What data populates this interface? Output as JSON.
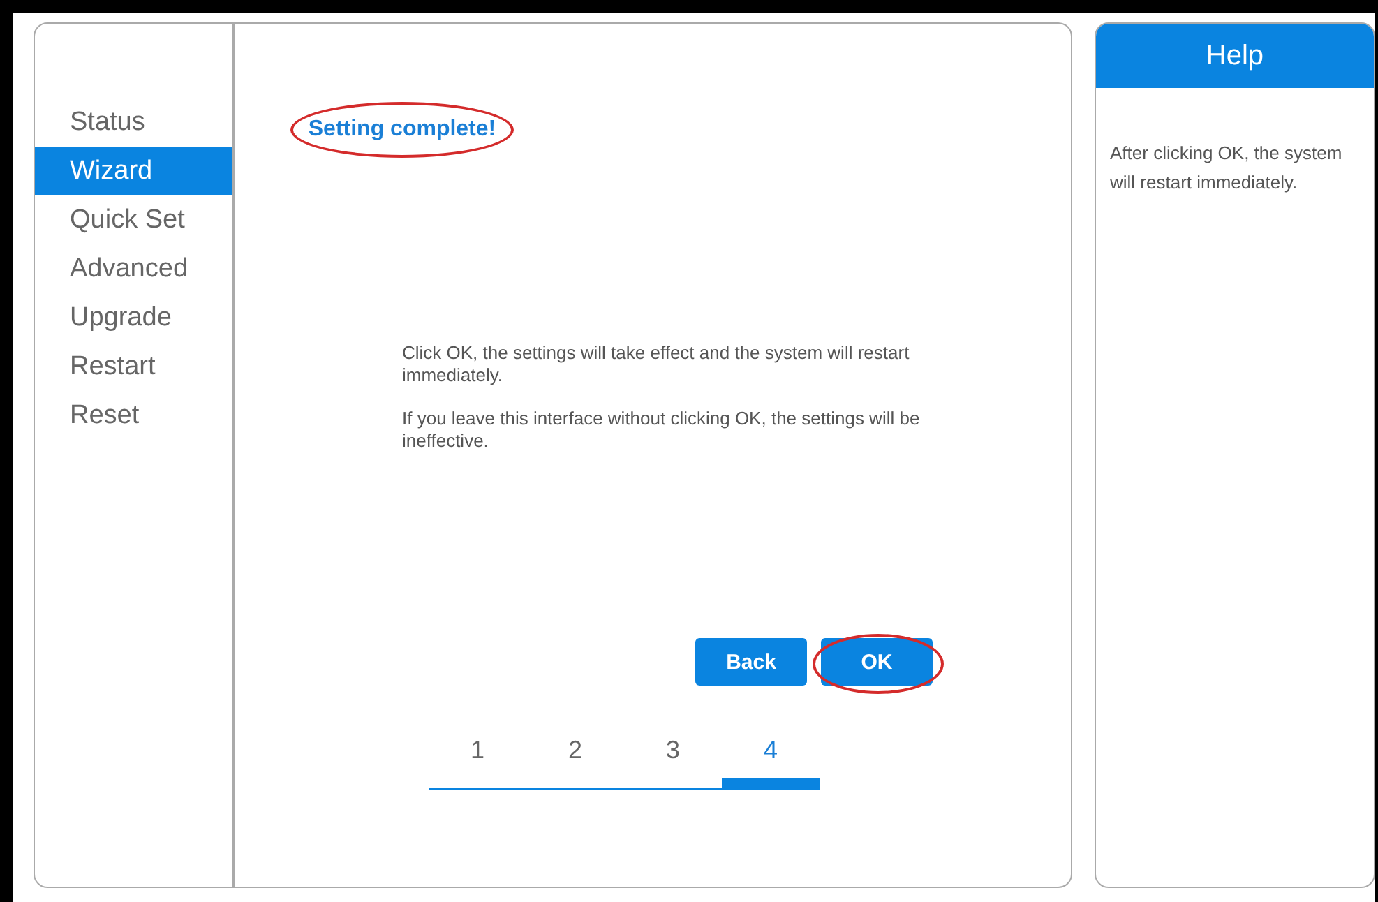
{
  "sidebar": {
    "items": [
      {
        "label": "Status",
        "selected": false
      },
      {
        "label": "Wizard",
        "selected": true
      },
      {
        "label": "Quick Set",
        "selected": false
      },
      {
        "label": "Advanced",
        "selected": false
      },
      {
        "label": "Upgrade",
        "selected": false
      },
      {
        "label": "Restart",
        "selected": false
      },
      {
        "label": "Reset",
        "selected": false
      }
    ]
  },
  "main": {
    "title": {
      "text": "Setting complete!",
      "circled": true
    },
    "paragraphs": [
      "Click OK, the settings will take effect and the system will restart immediately.",
      "If you leave this interface without clicking OK, the settings will be ineffective."
    ],
    "buttons": [
      {
        "label": "Back",
        "circled": false
      },
      {
        "label": "OK",
        "circled": true
      }
    ],
    "steps": [
      {
        "label": "1",
        "selected": false
      },
      {
        "label": "2",
        "selected": false
      },
      {
        "label": "3",
        "selected": false
      },
      {
        "label": "4",
        "selected": true
      }
    ]
  },
  "help": {
    "title": "Help",
    "text": "After clicking OK, the system will restart immediately."
  }
}
